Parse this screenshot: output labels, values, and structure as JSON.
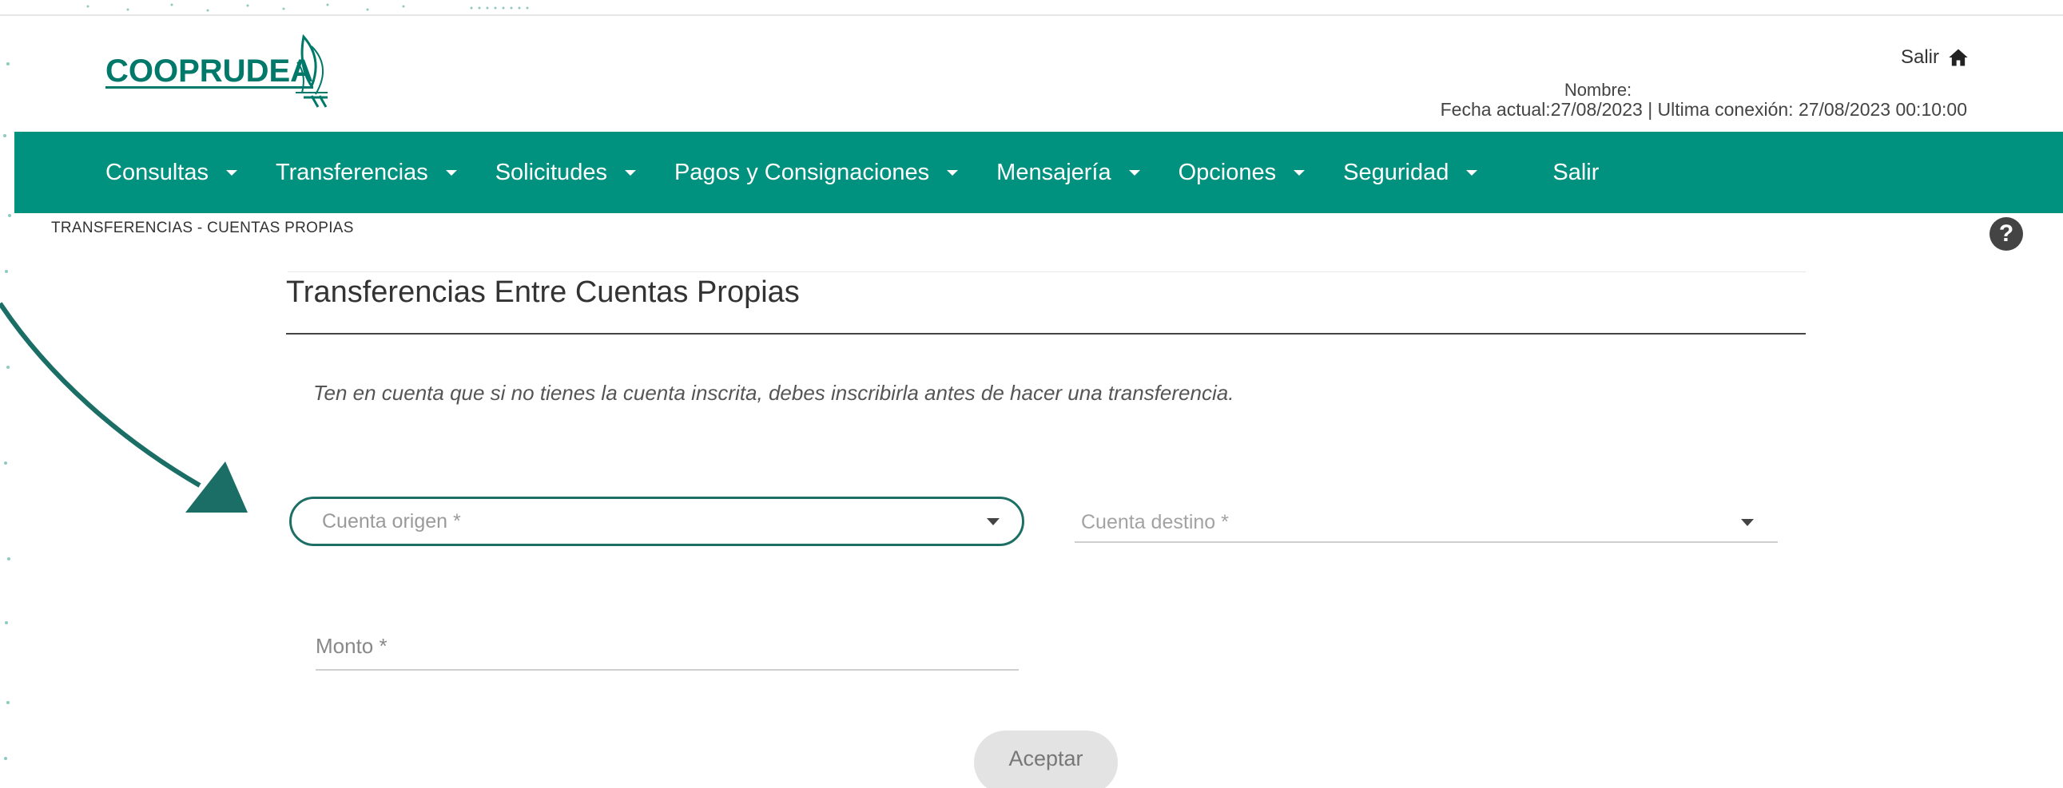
{
  "header": {
    "logo_text": "COOPRUDEA",
    "salir_label": "Salir",
    "nombre_label": "Nombre:",
    "fecha_line": "Fecha actual:27/08/2023 | Ultima conexión: 27/08/2023 00:10:00"
  },
  "nav": {
    "items": [
      {
        "label": "Consultas"
      },
      {
        "label": "Transferencias"
      },
      {
        "label": "Solicitudes"
      },
      {
        "label": "Pagos y Consignaciones"
      },
      {
        "label": "Mensajería"
      },
      {
        "label": "Opciones"
      },
      {
        "label": "Seguridad"
      }
    ],
    "salir_label": "Salir"
  },
  "breadcrumb": "TRANSFERENCIAS - CUENTAS PROPIAS",
  "help_glyph": "?",
  "page": {
    "title": "Transferencias Entre Cuentas Propias",
    "notice": "Ten en cuenta que si no tienes la cuenta inscrita, debes inscribirla antes de hacer una transferencia.",
    "origin_placeholder": "Cuenta origen *",
    "dest_placeholder": "Cuenta destino *",
    "monto_placeholder": "Monto *",
    "accept_label": "Aceptar"
  },
  "colors": {
    "brand_green": "#00917f",
    "dark_teal": "#1d6f66",
    "logo_green": "#00786a"
  },
  "icons": [
    "home-icon",
    "help-icon",
    "chevron-down-icon",
    "arrow-annotation"
  ]
}
